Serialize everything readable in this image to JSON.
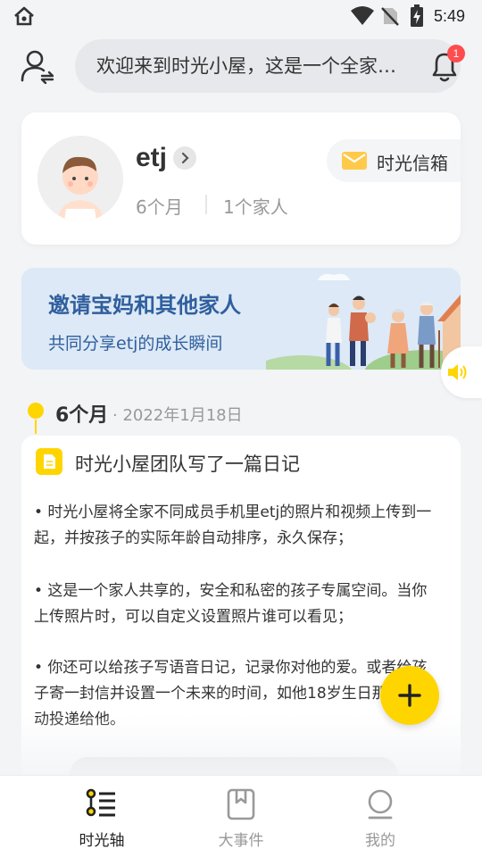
{
  "status_bar": {
    "time": "5:49"
  },
  "header": {
    "greeting": "欢迎来到时光小屋，这是一个全家共享的空间",
    "notification_count": "1"
  },
  "profile": {
    "name": "etj",
    "age": "6个月",
    "family_count": "1个家人",
    "mailbox_label": "时光信箱"
  },
  "invite_banner": {
    "title": "邀请宝妈和其他家人",
    "subtitle": "共同分享etj的成长瞬间"
  },
  "timeline": {
    "age": "6个月",
    "date": "· 2022年1月18日"
  },
  "diary": {
    "heading": "时光小屋团队写了一篇日记",
    "paragraphs": [
      "• 时光小屋将全家不同成员手机里etj的照片和视频上传到一起，并按孩子的实际年龄自动排序，永久保存；",
      "• 这是一个家人共享的，安全和私密的孩子专属空间。当你上传照片时，可以自定义设置照片谁可以看见；",
      "• 你还可以给孩子写语音日记，记录你对他的爱。或者给孩子寄一封信并设置一个未来的时间，如他18岁生日那天，自动投递给他。"
    ]
  },
  "bottom_nav": {
    "items": [
      {
        "label": "时光轴",
        "icon": "timeline-icon",
        "active": true
      },
      {
        "label": "大事件",
        "icon": "bookmark-book-icon",
        "active": false
      },
      {
        "label": "我的",
        "icon": "profile-icon",
        "active": false
      }
    ]
  },
  "colors": {
    "accent": "#ffd500",
    "banner_text": "#2f5f9e",
    "badge": "#ff4d4f"
  }
}
